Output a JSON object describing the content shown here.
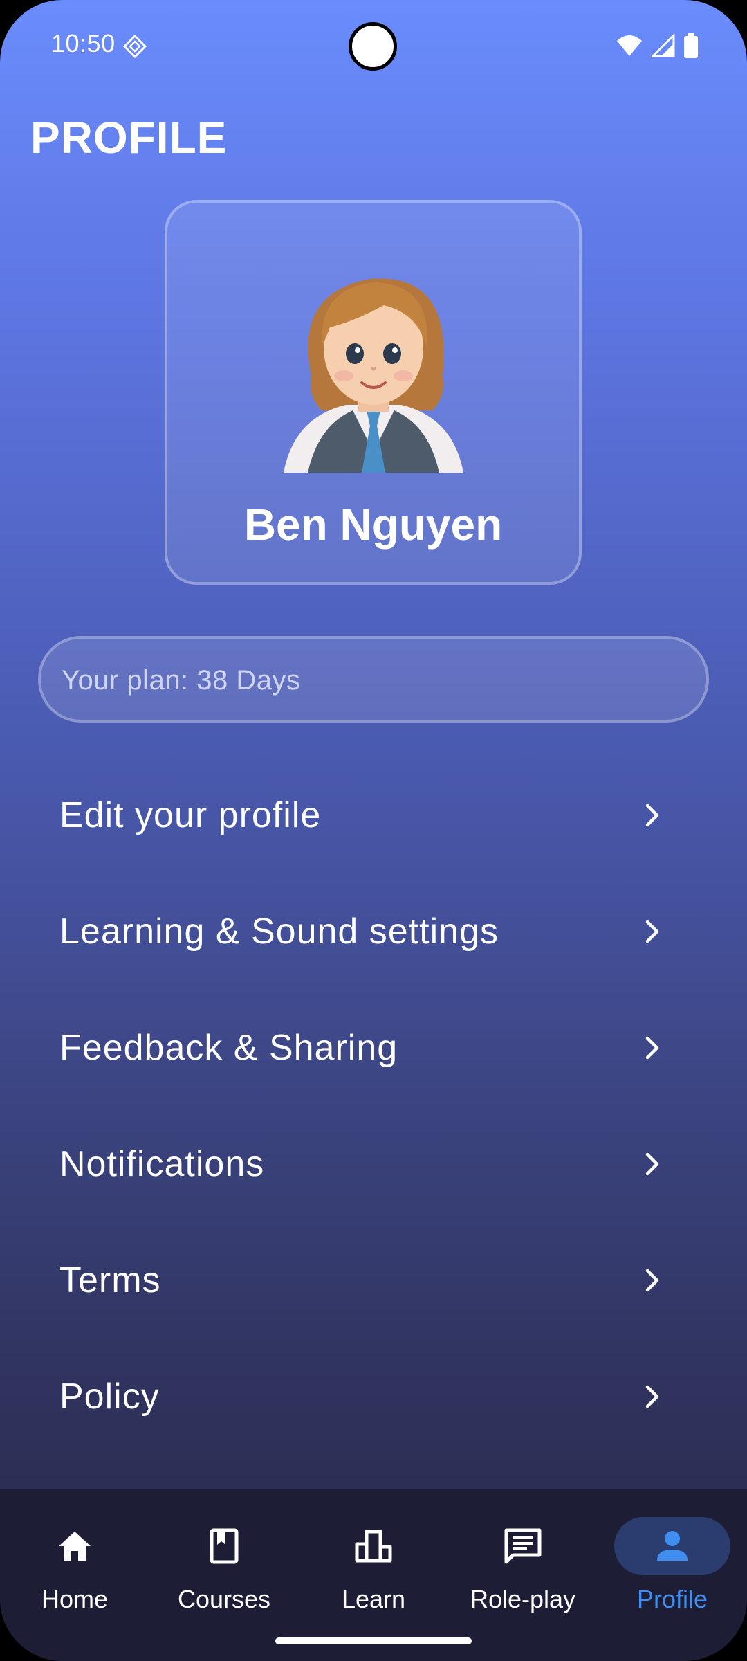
{
  "status_bar": {
    "time": "10:50"
  },
  "header": {
    "title": "PROFILE"
  },
  "profile": {
    "name": "Ben Nguyen"
  },
  "plan": {
    "text": "Your plan: 38 Days"
  },
  "menu": {
    "items": [
      {
        "label": "Edit your profile"
      },
      {
        "label": "Learning & Sound settings"
      },
      {
        "label": "Feedback & Sharing"
      },
      {
        "label": "Notifications"
      },
      {
        "label": "Terms"
      },
      {
        "label": "Policy"
      }
    ]
  },
  "nav": {
    "items": [
      {
        "label": "Home",
        "icon": "home-icon"
      },
      {
        "label": "Courses",
        "icon": "book-icon"
      },
      {
        "label": "Learn",
        "icon": "chart-icon"
      },
      {
        "label": "Role-play",
        "icon": "chat-icon"
      },
      {
        "label": "Profile",
        "icon": "person-icon",
        "active": true
      }
    ]
  },
  "colors": {
    "accent": "#3f8ef0",
    "active_pill": "#2a3d6e",
    "nav_background": "#1d1d36",
    "gradient_top": "#6a8cfc",
    "gradient_bottom": "#262744"
  }
}
